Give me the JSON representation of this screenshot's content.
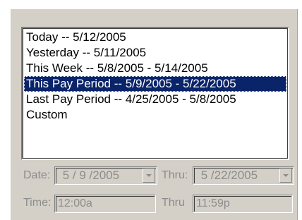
{
  "list": {
    "items": [
      {
        "label": "Today -- 5/12/2005",
        "selected": false
      },
      {
        "label": "Yesterday -- 5/11/2005",
        "selected": false
      },
      {
        "label": "This Week -- 5/8/2005 - 5/14/2005",
        "selected": false
      },
      {
        "label": "This Pay Period -- 5/9/2005 - 5/22/2005",
        "selected": true
      },
      {
        "label": "Last Pay Period -- 4/25/2005 - 5/8/2005",
        "selected": false
      },
      {
        "label": "Custom",
        "selected": false
      }
    ]
  },
  "date_from": {
    "label": "Date:",
    "value": " 5 / 9 /2005"
  },
  "date_thru": {
    "label": "Thru:",
    "value": " 5 /22/2005"
  },
  "time_from": {
    "label": "Time:",
    "value": "12:00a"
  },
  "time_thru": {
    "label": "Thru",
    "value": "11:59p"
  },
  "colors": {
    "selection": "#0a246a",
    "disabled_text": "#8c8c8c",
    "panel": "#d4d0c8"
  }
}
